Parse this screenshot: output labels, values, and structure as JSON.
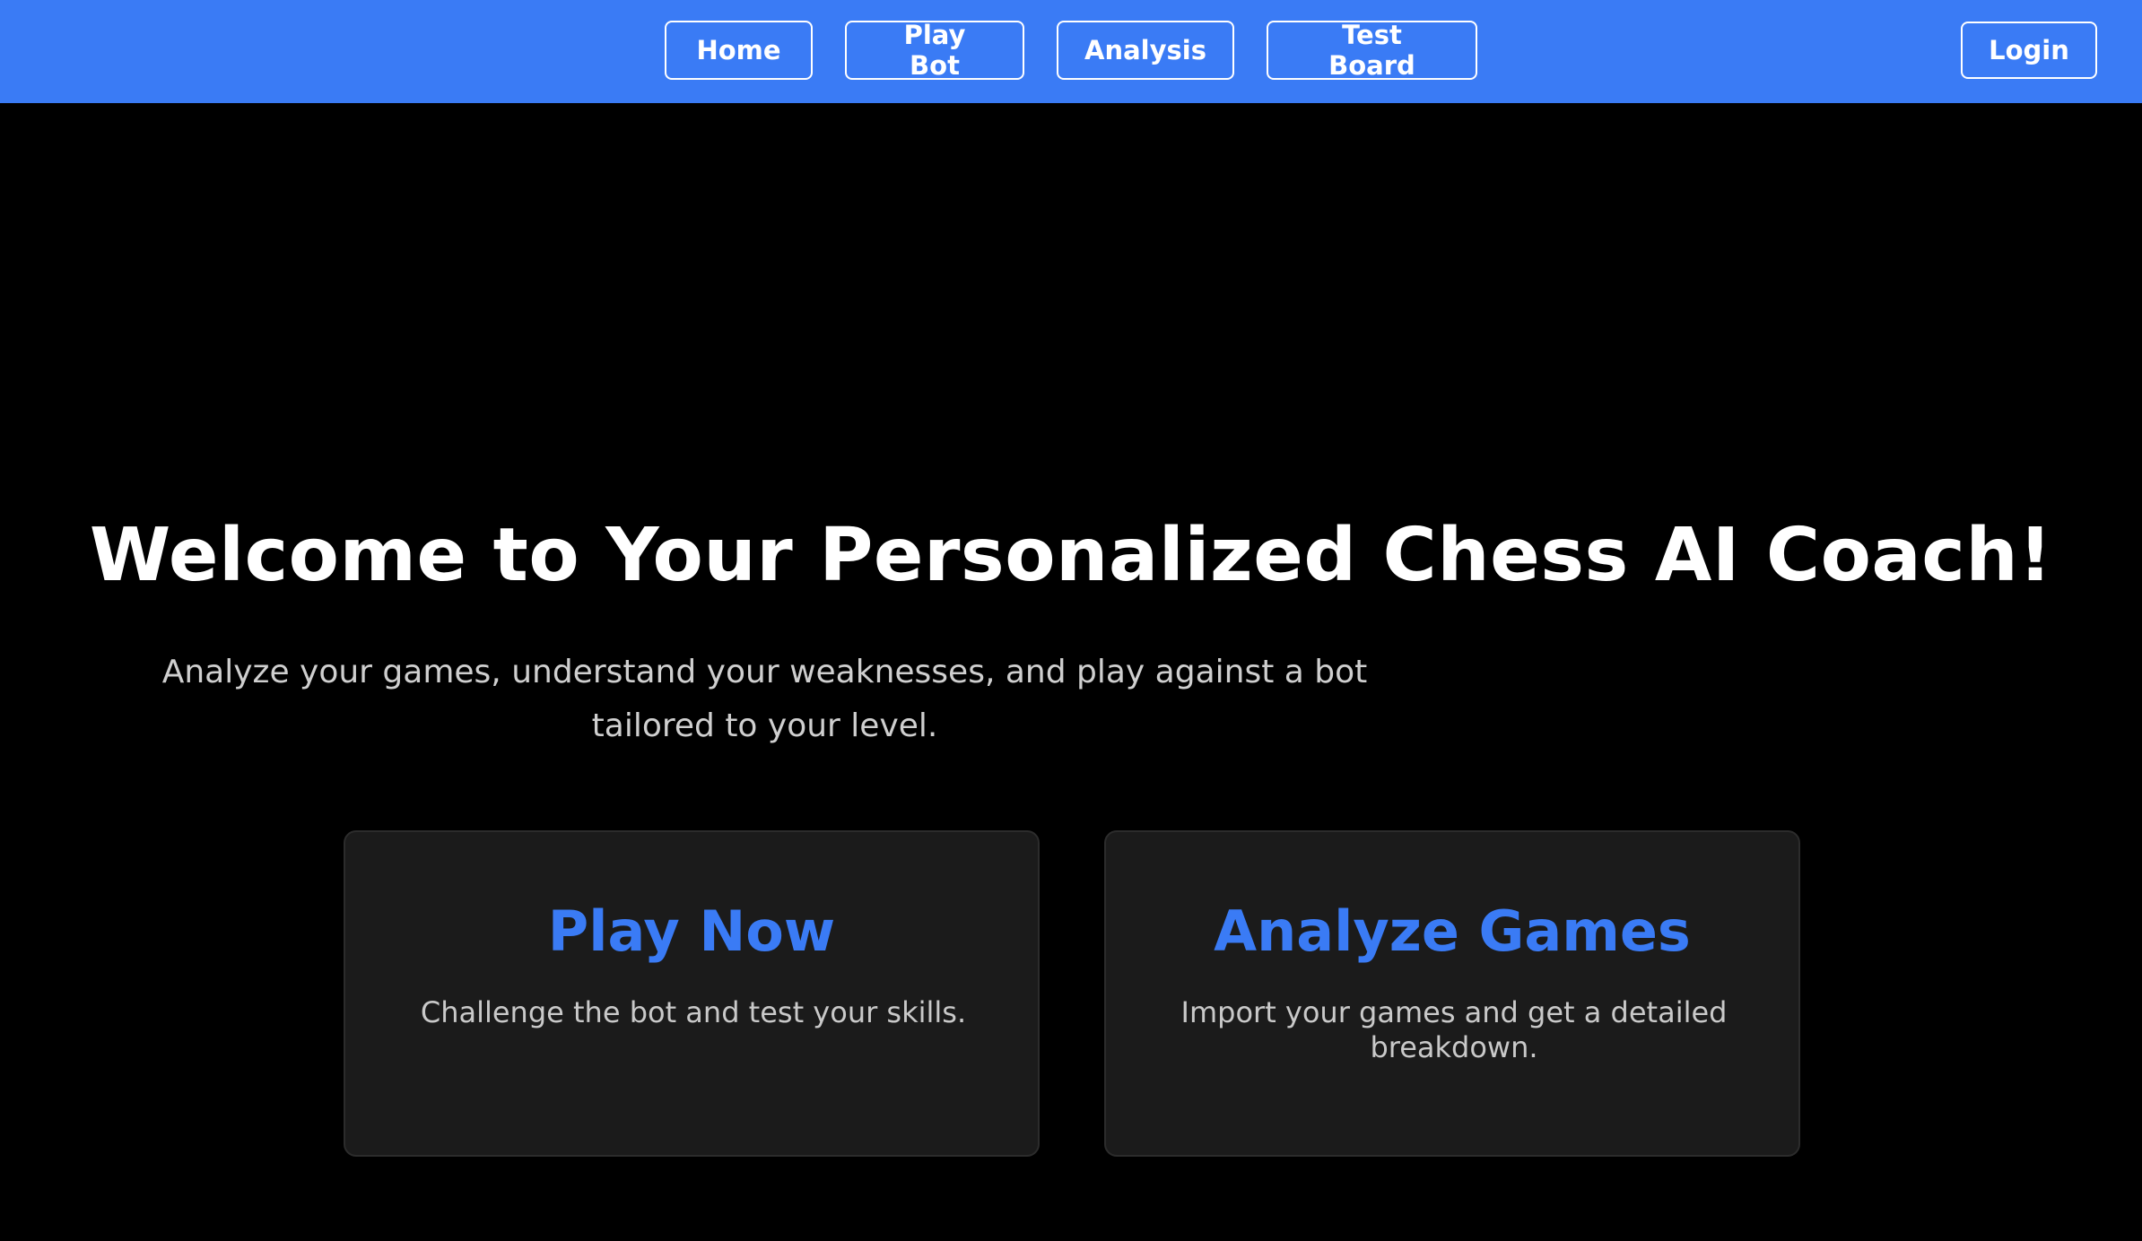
{
  "navbar": {
    "links": [
      {
        "label": "Home"
      },
      {
        "label": "Play Bot"
      },
      {
        "label": "Analysis"
      },
      {
        "label": "Test Board"
      }
    ],
    "login_label": "Login",
    "background_color": "#3a7bf5"
  },
  "hero": {
    "title": "Welcome to Your Personalized Chess AI Coach!",
    "subtitle": "Analyze your games, understand your weaknesses, and play against a bot tailored to your level."
  },
  "cards": [
    {
      "title": "Play Now",
      "description": "Challenge the bot and test your skills."
    },
    {
      "title": "Analyze Games",
      "description": "Import your games and get a detailed breakdown."
    }
  ],
  "colors": {
    "accent": "#3a7bf5",
    "page_background": "#000000",
    "card_background": "#1b1b1b"
  }
}
